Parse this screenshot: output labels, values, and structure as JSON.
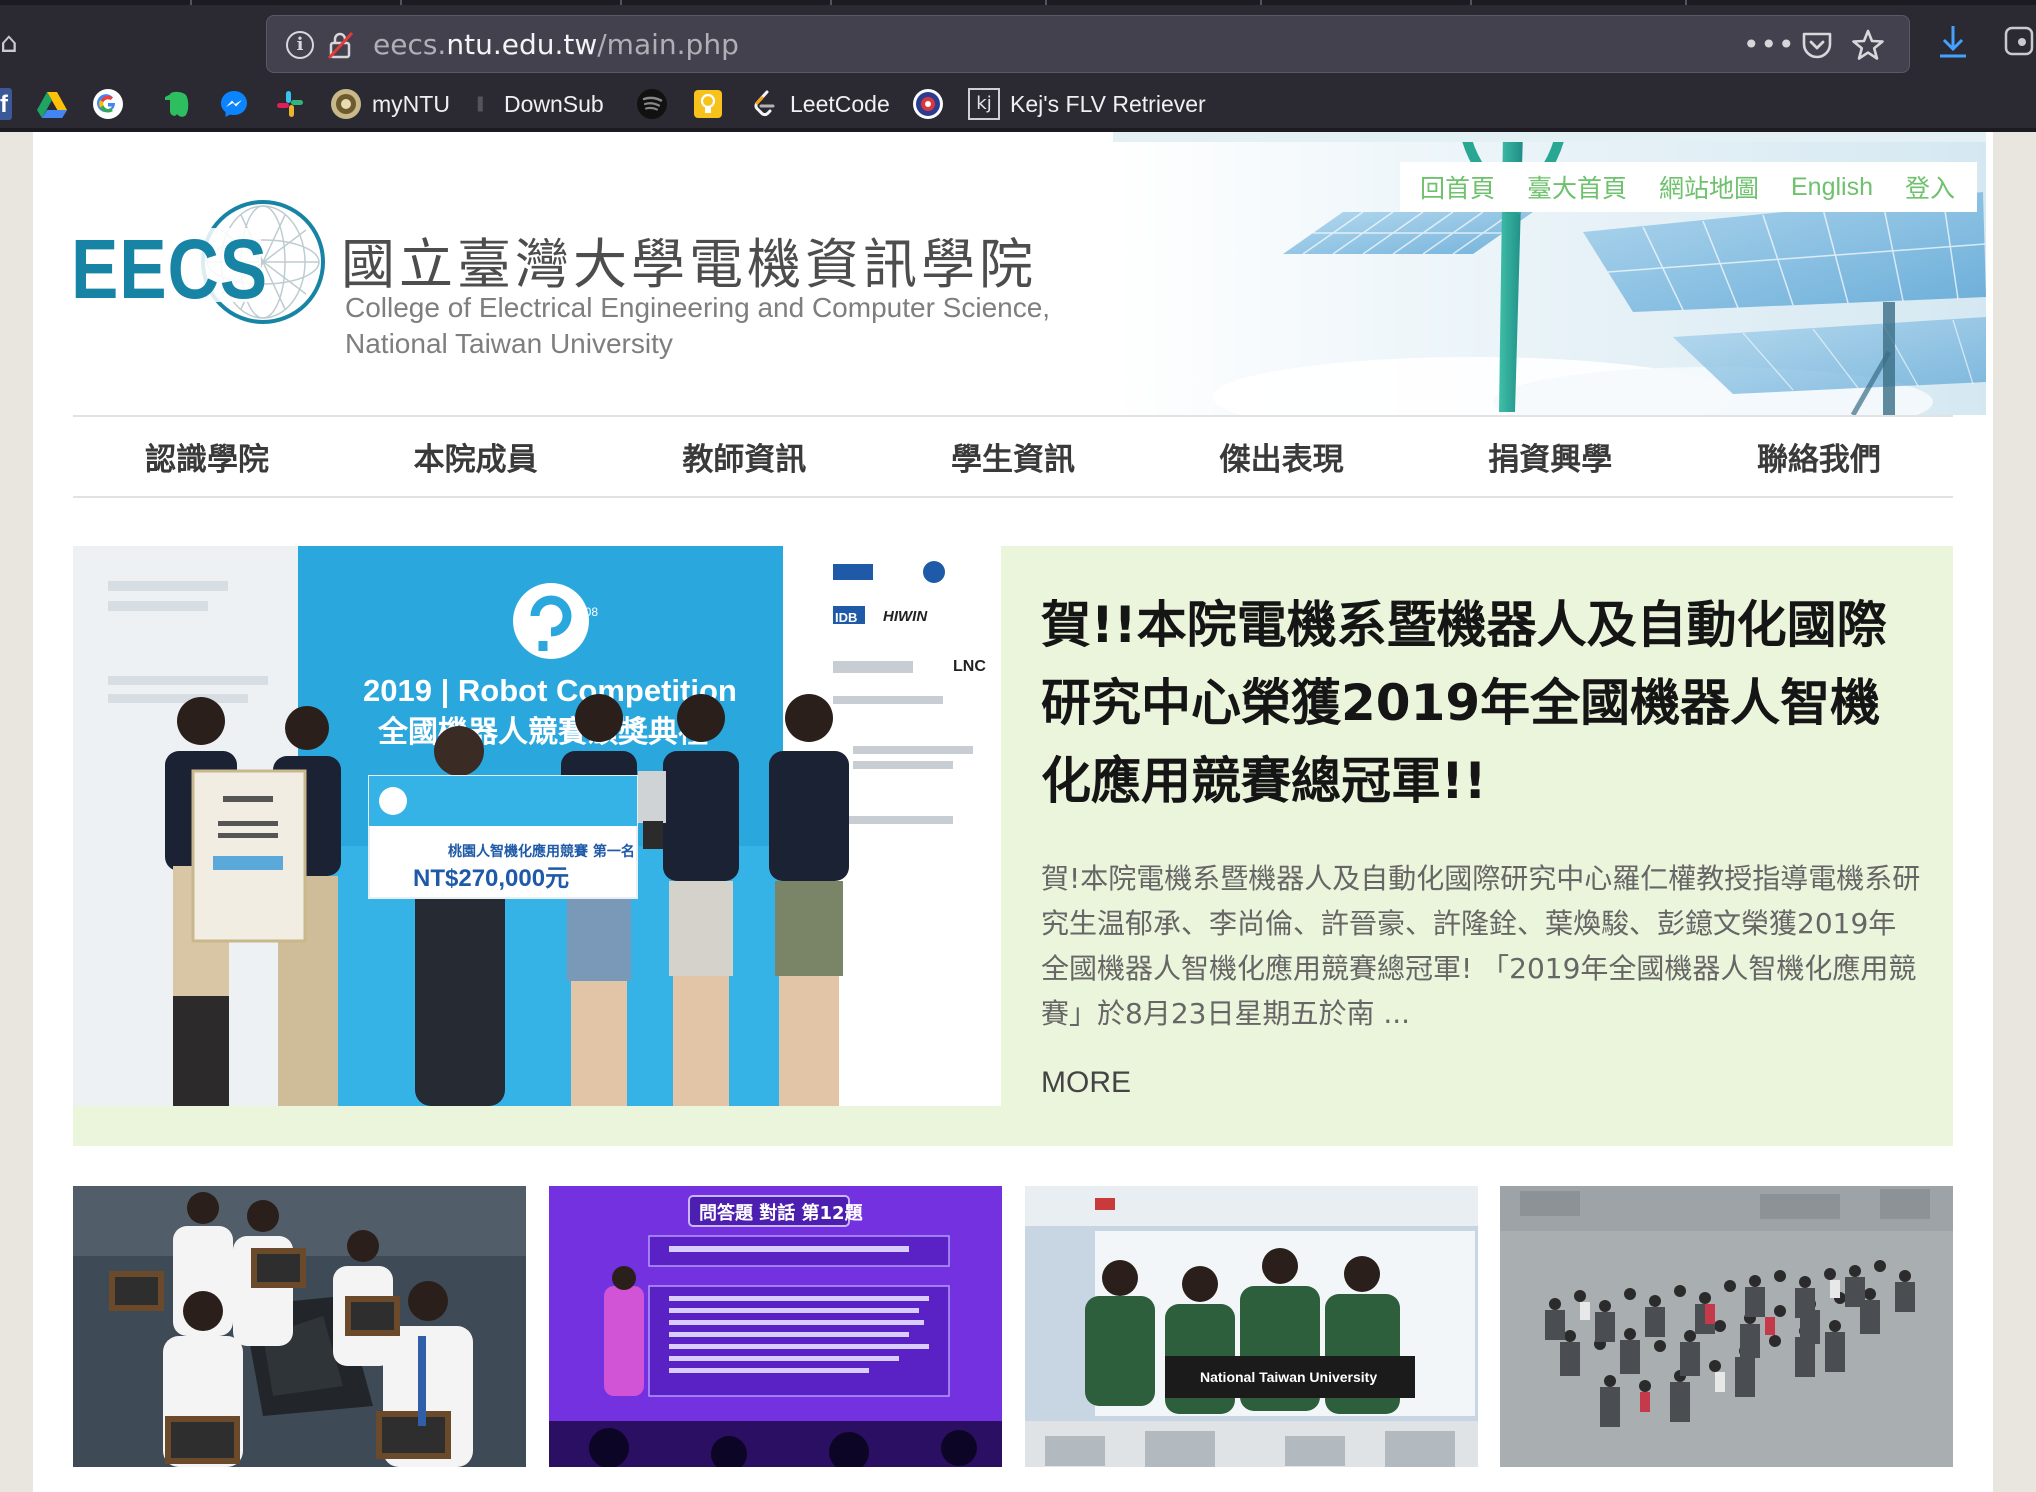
{
  "browser": {
    "url_scheme_hidden": "eecs.",
    "url_host": "ntu.edu.tw",
    "url_path": "/main.php",
    "more_label": "•••",
    "bookmarks": [
      {
        "label": "",
        "icon": "facebook-icon"
      },
      {
        "label": "",
        "icon": "google-drive-icon"
      },
      {
        "label": "",
        "icon": "google-icon"
      },
      {
        "label": "",
        "icon": "evernote-icon"
      },
      {
        "label": "",
        "icon": "messenger-icon"
      },
      {
        "label": "",
        "icon": "slack-icon"
      },
      {
        "label": "myNTU",
        "icon": "ntu-seal-icon"
      },
      {
        "label": "DownSub",
        "icon": "bookmark-icon"
      },
      {
        "label": "",
        "icon": "spotify-icon"
      },
      {
        "label": "",
        "icon": "lightbulb-icon"
      },
      {
        "label": "LeetCode",
        "icon": "leetcode-icon"
      },
      {
        "label": "",
        "icon": "ntu-emblem-icon"
      },
      {
        "label": "Kej's FLV Retriever",
        "icon": "kj-icon"
      }
    ]
  },
  "header": {
    "top_links": [
      "回首頁",
      "臺大首頁",
      "網站地圖",
      "English",
      "登入"
    ],
    "logo_text": "EECS",
    "college_name_zh": "國立臺灣大學電機資訊學院",
    "college_name_en_line1": "College of Electrical Engineering and Computer Science,",
    "college_name_en_line2": "National Taiwan University"
  },
  "nav": [
    "認識學院",
    "本院成員",
    "教師資訊",
    "學生資訊",
    "傑出表現",
    "捐資興學",
    "聯絡我們"
  ],
  "featured": {
    "title": "賀!!本院電機系暨機器人及自動化國際研究中心榮獲2019年全國機器人智機化應用競賽總冠軍!!",
    "summary": "賀!本院電機系暨機器人及自動化國際研究中心羅仁權教授指導電機系研究生温郁承、李尚倫、許晉豪、許隆銓、葉煥駿、彭鐿文榮獲2019年全國機器人智機化應用競賽總冠軍!   「2019年全國機器人智機化應用競賽」於8月23日星期五於南 ...",
    "more_label": "MORE",
    "photo": {
      "banner_year": "2019",
      "banner_title": "Robot Competition",
      "banner_zh": "全國機器人競賽頒獎典禮",
      "board_amount": "NT$270,000元",
      "board_line": "桃園人智機化應用競賽  第一名",
      "sponsor_labels": [
        "HIWIN",
        "LNC",
        "IDB"
      ]
    }
  },
  "thumbnails": [
    {
      "caption": ""
    },
    {
      "caption": "問答題 對話 第12題"
    },
    {
      "caption": "National Taiwan University"
    },
    {
      "caption": ""
    }
  ],
  "colors": {
    "accent_green": "#6ec16d",
    "featured_bg": "#eaf5dc",
    "logo_teal": "#1784a6"
  }
}
